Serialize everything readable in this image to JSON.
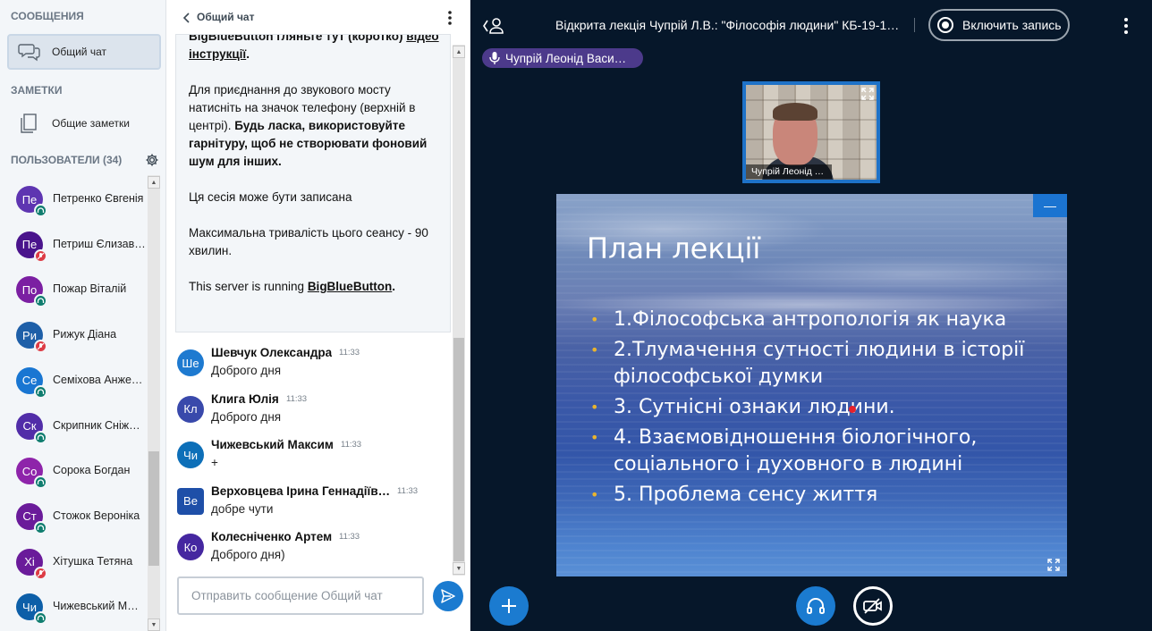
{
  "sidebar": {
    "messages_title": "СООБЩЕНИЯ",
    "public_chat_label": "Общий чат",
    "notes_title": "ЗАМЕТКИ",
    "shared_notes_label": "Общие заметки",
    "users_title": "ПОЛЬЗОВАТЕЛИ (34)",
    "users": [
      {
        "initials": "Пе",
        "name": "Петренко Євгенія",
        "color": "#5e35b1",
        "status": "listen"
      },
      {
        "initials": "Пе",
        "name": "Петриш Єлизав…",
        "color": "#4a148c",
        "status": "muted"
      },
      {
        "initials": "По",
        "name": "Пожар Віталій",
        "color": "#7b1fa2",
        "status": "listen"
      },
      {
        "initials": "Ри",
        "name": "Рижук Діана",
        "color": "#1e5fa8",
        "status": "muted"
      },
      {
        "initials": "Се",
        "name": "Семіхова Анже…",
        "color": "#1976d2",
        "status": "listen"
      },
      {
        "initials": "Ск",
        "name": "Скрипник Сніж…",
        "color": "#512da8",
        "status": "listen"
      },
      {
        "initials": "Со",
        "name": "Сорока Богдан",
        "color": "#8e24aa",
        "status": "listen"
      },
      {
        "initials": "Ст",
        "name": "Стожок Вероніка",
        "color": "#6a1b9a",
        "status": "listen"
      },
      {
        "initials": "Хі",
        "name": "Хітушка Тетяна",
        "color": "#6a1b9a",
        "status": "muted"
      },
      {
        "initials": "Чи",
        "name": "Чижевський М…",
        "color": "#0d5fa8",
        "status": "listen"
      }
    ]
  },
  "chat": {
    "header_title": "Общий чат",
    "welcome": {
      "line_partial_a": "BigBlueButton гляньте тут (коротко) ",
      "line_partial_link": "відео",
      "line2_link": "інструкції",
      "line2_tail": ".",
      "para2_a": "Для приєднання до звукового мосту натисніть на значок телефону (верхній в центрі). ",
      "para2_b": "Будь ласка, використовуйте гарнітуру, щоб не створювати фоновий шум для інших.",
      "para3": "Ця сесія може бути записана",
      "para4": "Максимальна тривалість цього сеансу - 90 хвилин.",
      "para5_a": "This server is running ",
      "para5_link": "BigBlueButton",
      "para5_tail": "."
    },
    "messages": [
      {
        "initials": "Ше",
        "name": "Шевчук Олександра",
        "time": "11:33",
        "text": "Доброго дня",
        "color": "#1e7ad0",
        "square": false
      },
      {
        "initials": "Кл",
        "name": "Клига Юлія",
        "time": "11:33",
        "text": "Доброго дня",
        "color": "#3949ab",
        "square": false
      },
      {
        "initials": "Чи",
        "name": "Чижевський Максим",
        "time": "11:33",
        "text": "+",
        "color": "#0d6fb8",
        "square": false
      },
      {
        "initials": "Ве",
        "name": "Верховцева Ірина Геннадіїв…",
        "time": "11:33",
        "text": "добре чути",
        "color": "#1e4fa8",
        "square": true
      },
      {
        "initials": "Ко",
        "name": "Колесніченко Артем",
        "time": "11:33",
        "text": "Доброго дня)",
        "color": "#4527a0",
        "square": false
      }
    ],
    "input_placeholder": "Отправить сообщение Общий чат"
  },
  "main": {
    "meeting_title": "Відкрита лекція Чупрій Л.В.: \"Філософія людини\" КБ-19-1, …",
    "record_label": "Включить запись",
    "talker_name": "Чупрій Леонід Васи…",
    "webcam_name": "Чупрій Леонід …",
    "slide": {
      "title": "План лекції",
      "items": [
        "1.Філософська антропологія як наука",
        "2.Тлумачення сутності людини в історії філософської думки",
        "3. Сутнісні ознаки людини.",
        "4. Взаємовідношення біологічного, соціального і духовного в людині",
        "5. Проблема сенсу життя"
      ]
    }
  },
  "colors": {
    "accent": "#1b7bd0",
    "muted_status": "#dd3c45",
    "listen_status": "#0f7d6f",
    "main_bg": "#06172a"
  }
}
